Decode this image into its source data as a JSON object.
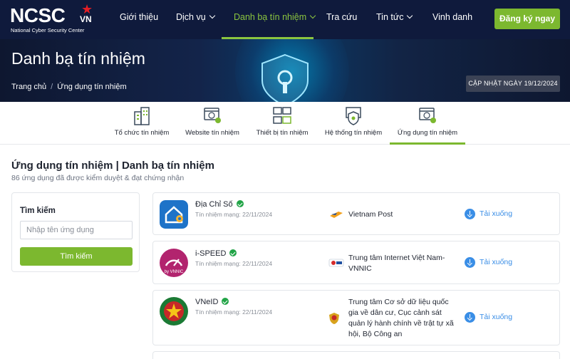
{
  "nav": {
    "logo_text": "NCSC",
    "logo_suffix": "VN",
    "logo_subtitle": "National Cyber Security Center",
    "items": [
      {
        "label": "Giới thiệu"
      },
      {
        "label": "Dịch vụ"
      },
      {
        "label": "Danh bạ tín nhiệm"
      },
      {
        "label": "Tra cứu"
      },
      {
        "label": "Tin tức"
      },
      {
        "label": "Vinh danh"
      }
    ],
    "register_label": "Đăng ký ngay"
  },
  "hero": {
    "title": "Danh bạ tín nhiệm",
    "breadcrumb": [
      "Trang chủ",
      "/",
      "Ứng dụng tín nhiệm"
    ],
    "update_badge": "CẬP NHẬT NGÀY 19/12/2024"
  },
  "tabs": [
    {
      "label": "Tổ chức tín nhiệm",
      "icon": "building-icon"
    },
    {
      "label": "Website tín nhiệm",
      "icon": "website-icon"
    },
    {
      "label": "Thiết bị tín nhiệm",
      "icon": "devices-icon"
    },
    {
      "label": "Hệ thống tín nhiệm",
      "icon": "system-shield-icon"
    },
    {
      "label": "Ứng dụng tín nhiệm",
      "icon": "app-icon"
    }
  ],
  "section": {
    "title": "Ứng dụng tín nhiệm | Danh bạ tín nhiệm",
    "subtitle": "86 ứng dụng đã được kiểm duyệt & đạt chứng nhận"
  },
  "search": {
    "label": "Tìm kiếm",
    "placeholder": "Nhập tên ứng dụng",
    "button_label": "Tìm kiếm"
  },
  "apps": [
    {
      "name": "Địa Chỉ Số",
      "date": "Tín nhiệm mạng: 22/11/2024",
      "org_lines": [
        "Vietnam Post"
      ],
      "download_label": "Tải xuống"
    },
    {
      "name": "i-SPEED",
      "date": "Tín nhiệm mạng: 22/11/2024",
      "org_lines": [
        "Trung tâm Internet Việt Nam-",
        "VNNIC"
      ],
      "download_label": "Tải xuống",
      "logo_text": "by VNNIC"
    },
    {
      "name": "VNeID",
      "date": "Tín nhiệm mạng: 22/11/2024",
      "org_lines": [
        "Trung tâm Cơ sở dữ liệu quốc",
        "gia về dân cư, Cục cảnh sát",
        "quản lý hành chính về trật tự xã",
        "hội, Bộ Công an"
      ],
      "download_label": "Tải xuống"
    }
  ],
  "colors": {
    "nav_bg": "#0f1a3c",
    "accent_green": "#7cb82f",
    "active_nav": "#8bc53f",
    "link_blue": "#3a8ee6",
    "verified_green": "#22a447"
  }
}
